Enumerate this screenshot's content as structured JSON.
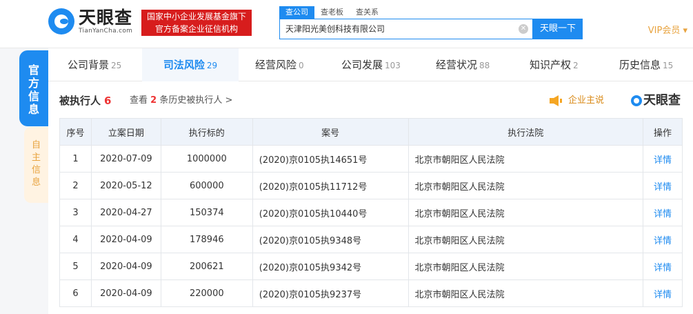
{
  "header": {
    "logo_name": "天眼查",
    "logo_domain": "TianYanCha.com",
    "banner_line1": "国家中小企业发展基金旗下",
    "banner_line2": "官方备案企业征信机构",
    "search_tabs": [
      "查公司",
      "查老板",
      "查关系"
    ],
    "search_value": "天津阳光美创科技有限公司",
    "search_button": "天眼一下",
    "vip_label": "VIP会员 ▾"
  },
  "side_tabs": {
    "official": "官方信息",
    "self": "自主信息"
  },
  "nav_tabs": [
    {
      "label": "公司背景",
      "count": "25"
    },
    {
      "label": "司法风险",
      "count": "29"
    },
    {
      "label": "经营风险",
      "count": "0"
    },
    {
      "label": "公司发展",
      "count": "103"
    },
    {
      "label": "经营状况",
      "count": "88"
    },
    {
      "label": "知识产权",
      "count": "2"
    },
    {
      "label": "历史信息",
      "count": "15"
    }
  ],
  "section": {
    "title": "被执行人",
    "count": "6",
    "history_prefix": "查看",
    "history_count": "2",
    "history_suffix": "条历史被执行人 >",
    "notice": "企业主说",
    "brand": "天眼查"
  },
  "table": {
    "headers": [
      "序号",
      "立案日期",
      "执行标的",
      "案号",
      "执行法院",
      "操作"
    ],
    "rows": [
      {
        "no": "1",
        "date": "2020-07-09",
        "amount": "1000000",
        "case": "(2020)京0105执14651号",
        "court": "北京市朝阳区人民法院",
        "action": "详情"
      },
      {
        "no": "2",
        "date": "2020-05-12",
        "amount": "600000",
        "case": "(2020)京0105执11712号",
        "court": "北京市朝阳区人民法院",
        "action": "详情"
      },
      {
        "no": "3",
        "date": "2020-04-27",
        "amount": "150374",
        "case": "(2020)京0105执10440号",
        "court": "北京市朝阳区人民法院",
        "action": "详情"
      },
      {
        "no": "4",
        "date": "2020-04-09",
        "amount": "178946",
        "case": "(2020)京0105执9348号",
        "court": "北京市朝阳区人民法院",
        "action": "详情"
      },
      {
        "no": "5",
        "date": "2020-04-09",
        "amount": "200621",
        "case": "(2020)京0105执9342号",
        "court": "北京市朝阳区人民法院",
        "action": "详情"
      },
      {
        "no": "6",
        "date": "2020-04-09",
        "amount": "220000",
        "case": "(2020)京0105执9237号",
        "court": "北京市朝阳区人民法院",
        "action": "详情"
      }
    ]
  },
  "colors": {
    "accent": "#1e8bf0",
    "danger": "#e33333",
    "vip": "#e8a33f"
  }
}
